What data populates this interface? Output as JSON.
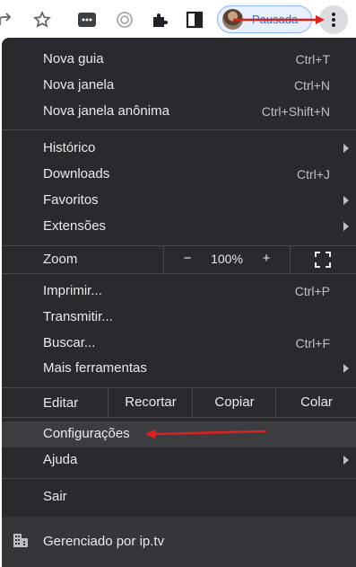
{
  "toolbar": {
    "icons": [
      "share-icon",
      "bookmark-star-icon",
      "extension-icon",
      "translate-icon",
      "puzzle-icon",
      "sidepanel-icon"
    ],
    "profile_label": "Pausada",
    "colors": {
      "profile_text": "#1a73e8",
      "annotation_red": "#e0201c"
    }
  },
  "menu": {
    "group1": [
      {
        "label": "Nova guia",
        "shortcut": "Ctrl+T"
      },
      {
        "label": "Nova janela",
        "shortcut": "Ctrl+N"
      },
      {
        "label": "Nova janela anônima",
        "shortcut": "Ctrl+Shift+N"
      }
    ],
    "group2": [
      {
        "label": "Histórico",
        "shortcut": ""
      },
      {
        "label": "Downloads",
        "shortcut": "Ctrl+J"
      },
      {
        "label": "Favoritos",
        "shortcut": ""
      },
      {
        "label": "Extensões",
        "shortcut": ""
      }
    ],
    "zoom": {
      "label": "Zoom",
      "minus": "−",
      "value": "100%",
      "plus": "+"
    },
    "group3": [
      {
        "label": "Imprimir...",
        "shortcut": "Ctrl+P"
      },
      {
        "label": "Transmitir...",
        "shortcut": ""
      },
      {
        "label": "Buscar...",
        "shortcut": "Ctrl+F"
      },
      {
        "label": "Mais ferramentas",
        "shortcut": ""
      }
    ],
    "edit": {
      "label": "Editar",
      "cut": "Recortar",
      "copy": "Copiar",
      "paste": "Colar"
    },
    "group4": [
      {
        "label": "Configurações"
      },
      {
        "label": "Ajuda"
      }
    ],
    "exit": "Sair",
    "managed": "Gerenciado por ip.tv",
    "colors": {
      "background": "#292a2d",
      "text": "#e8eaed",
      "shortcut": "#bdc1c6",
      "highlight": "#3c3d41"
    }
  }
}
